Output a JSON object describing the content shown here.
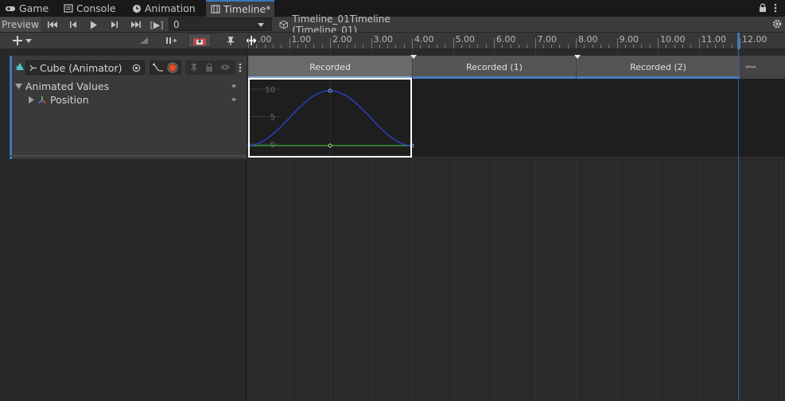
{
  "tabs": [
    {
      "label": "Game",
      "icon": "gamepad-icon"
    },
    {
      "label": "Console",
      "icon": "console-icon"
    },
    {
      "label": "Animation",
      "icon": "clock-icon"
    },
    {
      "label": "Timeline*",
      "icon": "film-icon",
      "active": true
    }
  ],
  "toolbar": {
    "preview_label": "Preview",
    "frame_value": "0",
    "play_range_label": "[▶]",
    "timeline_asset": "Timeline_01Timeline (Timeline_01)"
  },
  "ruler": {
    "labels": [
      "1.00",
      "2.00",
      "3.00",
      "4.00",
      "5.00",
      "6.00",
      "7.00",
      "8.00",
      "9.00",
      "10.00",
      "11.00",
      "12.00"
    ],
    "start_label": ".00"
  },
  "track": {
    "binding_label": "Cube (Animator)",
    "curves_group": "Animated Values",
    "property": "Position"
  },
  "clips": [
    {
      "label": "Recorded",
      "start": 0,
      "end": 4,
      "selected": true
    },
    {
      "label": "Recorded (1)",
      "start": 4,
      "end": 8
    },
    {
      "label": "Recorded (2)",
      "start": 8,
      "end": 12
    }
  ],
  "infinite_icon": "infinity-icon",
  "curve": {
    "y_labels": [
      "10",
      "5",
      "0"
    ],
    "peak_value": 10,
    "peak_time": 2.0
  },
  "colors": {
    "accent": "#3a79bb",
    "clip_bar": "#4a7dc4",
    "curve": "#2c3fc8",
    "baseline": "#3ab03a",
    "record": "#e0502a"
  }
}
